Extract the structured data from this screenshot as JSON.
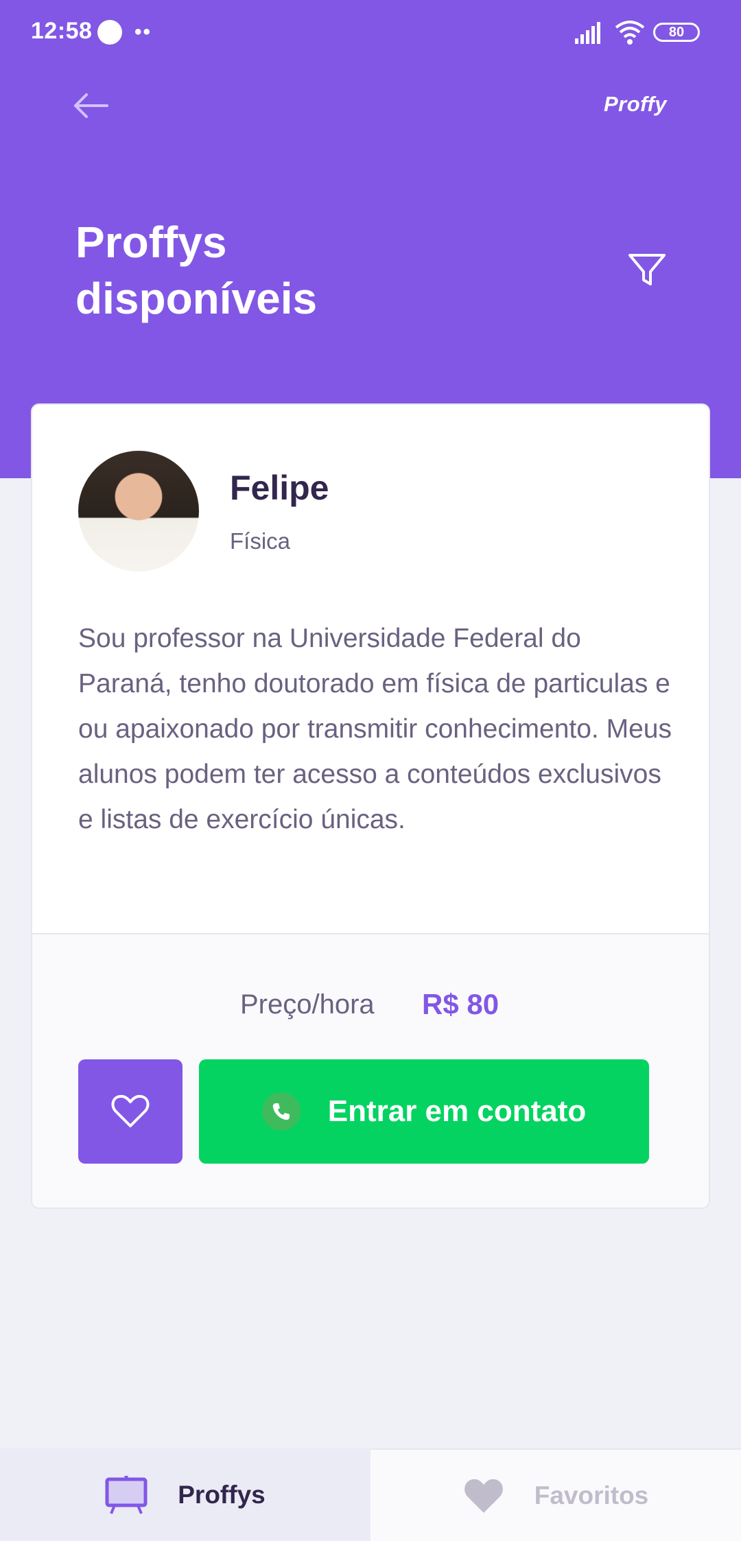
{
  "status_bar": {
    "time": "12:58",
    "dots": "••",
    "battery": "80"
  },
  "header": {
    "brand": "Proffy",
    "title_line1": "Proffys",
    "title_line2": "disponíveis",
    "back_icon": "arrow-left-icon",
    "filter_icon": "filter-icon"
  },
  "card": {
    "name": "Felipe",
    "subject": "Física",
    "bio": "Sou professor na Universidade Federal do Paraná, tenho doutorado em física de particulas e ou apaixonado por transmitir conhecimento. Meus alunos podem ter acesso a conteúdos exclusivos e listas de exercício únicas.",
    "price_label": "Preço/hora",
    "price_value": "R$ 80",
    "contact_label": "Entrar em contato"
  },
  "tabs": [
    {
      "label": "Proffys",
      "icon": "easel-icon",
      "active": true
    },
    {
      "label": "Favoritos",
      "icon": "heart-icon",
      "active": false
    }
  ],
  "colors": {
    "primary": "#8257E5",
    "secondary": "#04D361",
    "background": "#F0F0F7",
    "title_text": "#32264D",
    "body_text": "#6A6180",
    "inactive": "#C1BCCC"
  }
}
